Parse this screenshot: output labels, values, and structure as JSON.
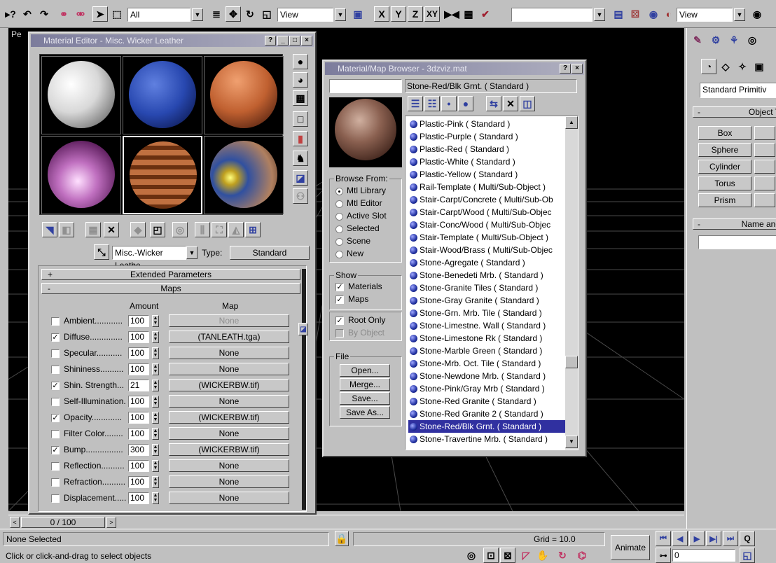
{
  "toolbar": {
    "selection_filter": "All",
    "ref_coord_1": "View",
    "axes": [
      "X",
      "Y",
      "Z",
      "XY"
    ],
    "named_selection": "",
    "ref_coord_2": "View"
  },
  "viewport": {
    "label": "Pe"
  },
  "material_editor": {
    "title": "Material Editor - Misc. Wicker Leather",
    "material_name": "Misc.-Wicker Leathe",
    "type_label": "Type:",
    "type_value": "Standard",
    "rollouts": {
      "extended": "Extended Parameters",
      "maps": "Maps"
    },
    "headers": {
      "amount": "Amount",
      "map": "Map"
    },
    "maps": [
      {
        "checked": false,
        "label": "Ambient............",
        "amount": "100",
        "map": "None",
        "disabled": true
      },
      {
        "checked": true,
        "label": "Diffuse..............",
        "amount": "100",
        "map": "(TANLEATH.tga)",
        "disabled": false
      },
      {
        "checked": false,
        "label": "Specular...........",
        "amount": "100",
        "map": "None",
        "disabled": false
      },
      {
        "checked": false,
        "label": "Shininess..........",
        "amount": "100",
        "map": "None",
        "disabled": false
      },
      {
        "checked": true,
        "label": "Shin. Strength...",
        "amount": "21",
        "map": "(WICKERBW.tif)",
        "disabled": false
      },
      {
        "checked": false,
        "label": "Self-Illumination.",
        "amount": "100",
        "map": "None",
        "disabled": false
      },
      {
        "checked": true,
        "label": "Opacity.............",
        "amount": "100",
        "map": "(WICKERBW.tif)",
        "disabled": false
      },
      {
        "checked": false,
        "label": "Filter Color........",
        "amount": "100",
        "map": "None",
        "disabled": false
      },
      {
        "checked": true,
        "label": "Bump................",
        "amount": "300",
        "map": "(WICKERBW.tif)",
        "disabled": false
      },
      {
        "checked": false,
        "label": "Reflection..........",
        "amount": "100",
        "map": "None",
        "disabled": false
      },
      {
        "checked": false,
        "label": "Refraction..........",
        "amount": "100",
        "map": "None",
        "disabled": false
      },
      {
        "checked": false,
        "label": "Displacement.....",
        "amount": "100",
        "map": "None",
        "disabled": false
      }
    ]
  },
  "browser": {
    "title": "Material/Map Browser - 3dzviz.mat",
    "search_value": "",
    "current": "Stone-Red/Blk Grnt. ( Standard )",
    "browse_from_label": "Browse From:",
    "browse_from": [
      {
        "label": "Mtl Library",
        "on": true
      },
      {
        "label": "Mtl Editor",
        "on": false
      },
      {
        "label": "Active Slot",
        "on": false
      },
      {
        "label": "Selected",
        "on": false
      },
      {
        "label": "Scene",
        "on": false
      },
      {
        "label": "New",
        "on": false
      }
    ],
    "show_label": "Show",
    "show": [
      {
        "label": "Materials",
        "checked": true
      },
      {
        "label": "Maps",
        "checked": true
      }
    ],
    "root_only": "Root Only",
    "by_object": "By Object",
    "file_label": "File",
    "file_buttons": [
      "Open...",
      "Merge...",
      "Save...",
      "Save As..."
    ],
    "items": [
      "Plastic-Pink ( Standard )",
      "Plastic-Purple ( Standard )",
      "Plastic-Red ( Standard )",
      "Plastic-White ( Standard )",
      "Plastic-Yellow ( Standard )",
      "Rail-Template ( Multi/Sub-Object )",
      "Stair-Carpt/Concrete ( Multi/Sub-Ob",
      "Stair-Carpt/Wood ( Multi/Sub-Objec",
      "Stair-Conc/Wood ( Multi/Sub-Objec",
      "Stair-Template ( Multi/Sub-Object )",
      "Stair-Wood/Brass ( Multi/Sub-Objec",
      "Stone-Agregate ( Standard )",
      "Stone-Benedeti Mrb. ( Standard )",
      "Stone-Granite Tiles ( Standard )",
      "Stone-Gray Granite ( Standard )",
      "Stone-Grn. Mrb. Tile ( Standard )",
      "Stone-Limestne. Wall ( Standard )",
      "Stone-Limestone Rk ( Standard )",
      "Stone-Marble Green ( Standard )",
      "Stone-Mrb. Oct. Tile ( Standard )",
      "Stone-Newdone Mrb. ( Standard )",
      "Stone-Pink/Gray Mrb ( Standard )",
      "Stone-Red Granite ( Standard )",
      "Stone-Red Granite 2 ( Standard )",
      "Stone-Red/Blk Grnt. ( Standard )",
      "Stone-Travertine Mrb. ( Standard )"
    ],
    "selected_index": 24
  },
  "command_panel": {
    "dropdown": "Standard Primitiv",
    "rollout1": "Object T",
    "buttons": [
      "Box",
      "Sphere",
      "Cylinder",
      "Torus",
      "Prism"
    ],
    "rollout2": "Name and"
  },
  "timeslider": {
    "value": "0 / 100"
  },
  "status": {
    "selection": "None Selected",
    "prompt": "Click or click-and-drag to select objects",
    "grid": "Grid = 10.0",
    "animate": "Animate",
    "frame": "0"
  },
  "colors": {
    "selected_row": "#3030a0",
    "viewport": "#000000"
  }
}
